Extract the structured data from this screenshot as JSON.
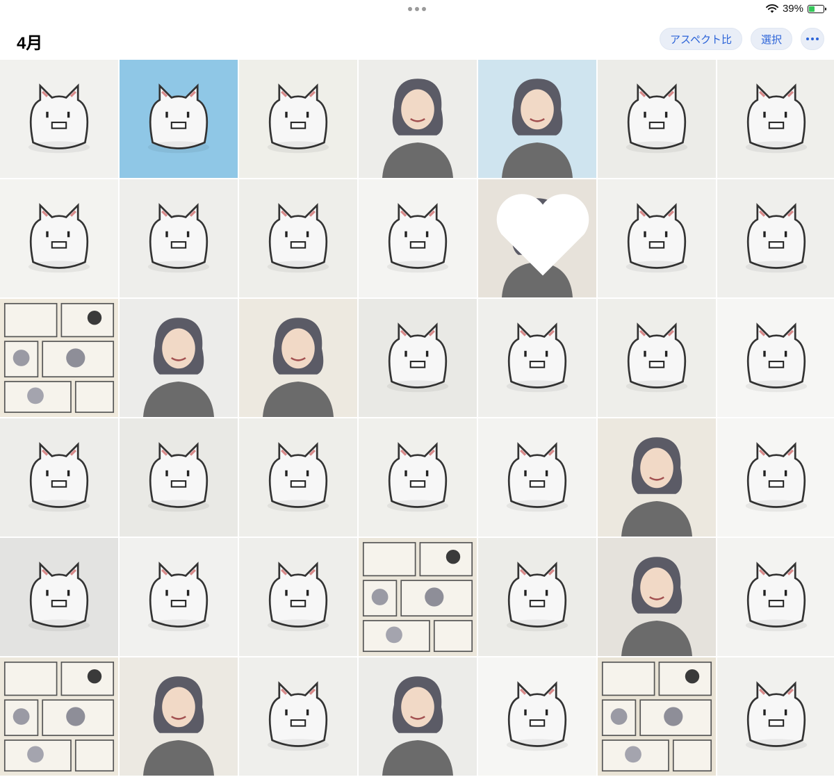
{
  "status": {
    "battery_text": "39%",
    "battery_color": "#34c759"
  },
  "header": {
    "title": "4月",
    "aspect_label": "アスペクト比",
    "select_label": "選択"
  },
  "colors": {
    "accent": "#2b63d8",
    "pill_bg": "#e9eef7"
  },
  "grid": {
    "columns": 7,
    "rows": 6,
    "tiles": [
      {
        "subject": "cat",
        "bg": "#f1f1ee",
        "fav": false
      },
      {
        "subject": "cat",
        "bg": "#8fc7e6",
        "fav": false
      },
      {
        "subject": "cat",
        "bg": "#efefe9",
        "fav": false
      },
      {
        "subject": "person",
        "bg": "#ededea",
        "fav": false
      },
      {
        "subject": "person",
        "bg": "#cfe4ef",
        "fav": false
      },
      {
        "subject": "cat",
        "bg": "#ecece8",
        "fav": false
      },
      {
        "subject": "cat",
        "bg": "#efefeb",
        "fav": false
      },
      {
        "subject": "cat",
        "bg": "#f3f3f0",
        "fav": false
      },
      {
        "subject": "cat",
        "bg": "#eeeeeb",
        "fav": false
      },
      {
        "subject": "cat",
        "bg": "#eeeeea",
        "fav": false
      },
      {
        "subject": "cat",
        "bg": "#f4f4f2",
        "fav": false
      },
      {
        "subject": "person",
        "bg": "#e7e2da",
        "fav": true
      },
      {
        "subject": "cat",
        "bg": "#f1f1ee",
        "fav": false
      },
      {
        "subject": "cat",
        "bg": "#efefec",
        "fav": false
      },
      {
        "subject": "comic",
        "bg": "#efe9dc",
        "fav": false
      },
      {
        "subject": "person",
        "bg": "#ececea",
        "fav": false
      },
      {
        "subject": "person",
        "bg": "#ede9e0",
        "fav": false
      },
      {
        "subject": "cat",
        "bg": "#e9e9e5",
        "fav": false
      },
      {
        "subject": "cat",
        "bg": "#efefec",
        "fav": false
      },
      {
        "subject": "cat",
        "bg": "#eeeeea",
        "fav": false
      },
      {
        "subject": "cat",
        "bg": "#f6f6f4",
        "fav": false
      },
      {
        "subject": "cat",
        "bg": "#ededea",
        "fav": false
      },
      {
        "subject": "cat",
        "bg": "#e9e9e5",
        "fav": false
      },
      {
        "subject": "cat",
        "bg": "#eeeeea",
        "fav": false
      },
      {
        "subject": "cat",
        "bg": "#f0f0ec",
        "fav": false
      },
      {
        "subject": "cat",
        "bg": "#f3f3f1",
        "fav": false
      },
      {
        "subject": "person",
        "bg": "#ece8df",
        "fav": false
      },
      {
        "subject": "cat",
        "bg": "#f6f6f4",
        "fav": false
      },
      {
        "subject": "cat",
        "bg": "#e3e3e1",
        "fav": false
      },
      {
        "subject": "cat",
        "bg": "#f1f1ef",
        "fav": false
      },
      {
        "subject": "cat",
        "bg": "#eeeeeb",
        "fav": false
      },
      {
        "subject": "comic",
        "bg": "#ebe6da",
        "fav": false
      },
      {
        "subject": "cat",
        "bg": "#ecece8",
        "fav": false
      },
      {
        "subject": "person",
        "bg": "#e5e2dc",
        "fav": false
      },
      {
        "subject": "cat",
        "bg": "#f3f3f1",
        "fav": false
      },
      {
        "subject": "comic",
        "bg": "#ede8dc",
        "fav": false
      },
      {
        "subject": "person",
        "bg": "#ece9e2",
        "fav": false
      },
      {
        "subject": "cat",
        "bg": "#efefec",
        "fav": false
      },
      {
        "subject": "person",
        "bg": "#ecece9",
        "fav": false
      },
      {
        "subject": "cat",
        "bg": "#f6f6f4",
        "fav": false
      },
      {
        "subject": "comic",
        "bg": "#e9e3d5",
        "fav": false
      },
      {
        "subject": "cat",
        "bg": "#f1f1ee",
        "fav": false
      }
    ]
  }
}
